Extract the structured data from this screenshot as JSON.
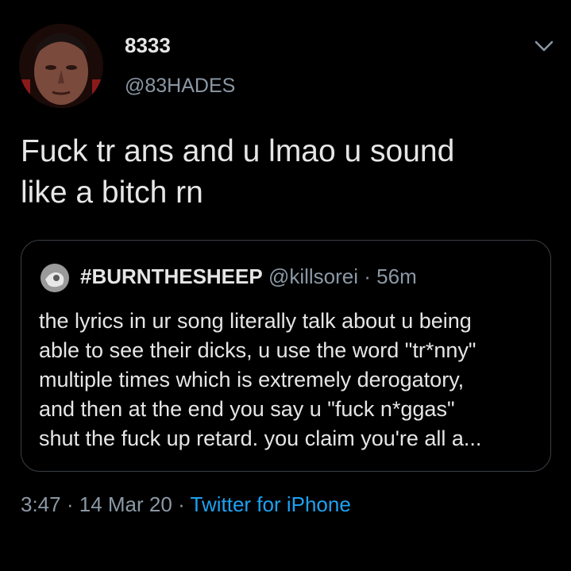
{
  "author": {
    "display_name": "8333",
    "handle": "@83HADES"
  },
  "tweet": {
    "text_line1": "Fuck tr ans and u lmao u sound",
    "text_line2": "like a bitch rn"
  },
  "quoted": {
    "display_name": "#BURNTHESHEEP",
    "handle": "@killsorei",
    "separator": "·",
    "time": "56m",
    "lines": [
      "the lyrics in ur song literally talk about u being",
      "able to see their dicks, u use the word \"tr*nny\"",
      "multiple times which is extremely derogatory,",
      "and then at the end you say u \"fuck n*ggas\"",
      "shut the fuck up retard. you claim you're all a..."
    ]
  },
  "meta": {
    "time": "3:47",
    "sep1": "·",
    "date": "14 Mar 20",
    "sep2": "·",
    "source": "Twitter for iPhone"
  },
  "icons": {
    "menu": "chevron-down-icon"
  },
  "colors": {
    "background": "#000000",
    "primary_text": "#e6e6e6",
    "secondary_text": "#8b98a5",
    "accent": "#1da1f2",
    "card_border": "#3a3f44"
  }
}
